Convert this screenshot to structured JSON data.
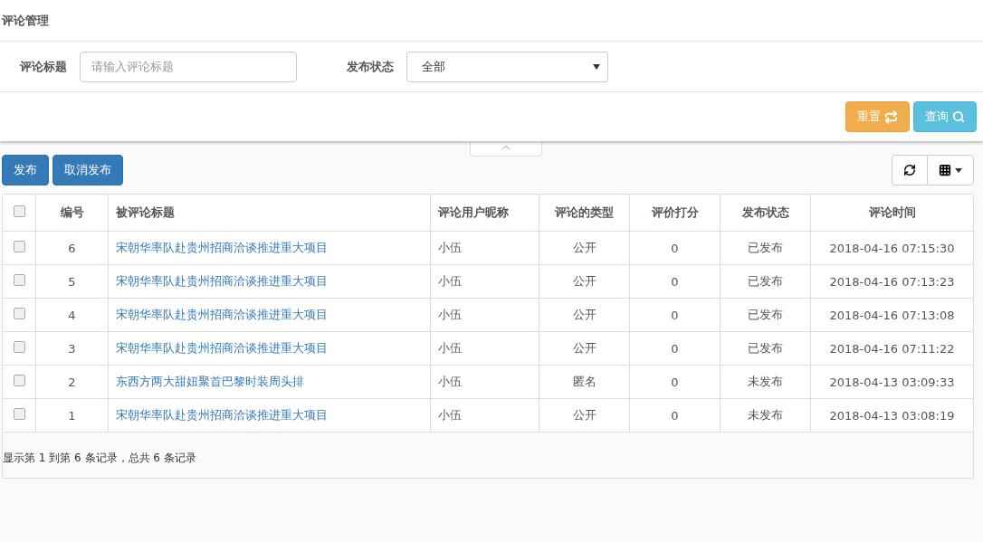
{
  "page_title": "评论管理",
  "filters": [
    {
      "kind": "text",
      "label": "评论标题",
      "placeholder": "请输入评论标题"
    },
    {
      "kind": "select",
      "label": "发布状态",
      "value": "全部"
    }
  ],
  "form_buttons": [
    {
      "label": "重置",
      "kind": "reset"
    },
    {
      "label": "查询",
      "kind": "search"
    }
  ],
  "actions": [
    "发布",
    "取消发布"
  ],
  "table": {
    "select_all_checked": false,
    "columns": [
      "编号",
      "被评论标题",
      "评论用户昵称",
      "评论的类型",
      "评价打分",
      "发布状态",
      "评论时间"
    ],
    "rows": [
      {
        "checked": false,
        "cells": [
          "6",
          "宋朝华率队赴贵州招商洽谈推进重大项目",
          "小伍",
          "公开",
          "0",
          "已发布",
          "2018-04-16 07:15:30"
        ]
      },
      {
        "checked": false,
        "cells": [
          "5",
          "宋朝华率队赴贵州招商洽谈推进重大项目",
          "小伍",
          "公开",
          "0",
          "已发布",
          "2018-04-16 07:13:23"
        ]
      },
      {
        "checked": false,
        "cells": [
          "4",
          "宋朝华率队赴贵州招商洽谈推进重大项目",
          "小伍",
          "公开",
          "0",
          "已发布",
          "2018-04-16 07:13:08"
        ]
      },
      {
        "checked": false,
        "cells": [
          "3",
          "宋朝华率队赴贵州招商洽谈推进重大项目",
          "小伍",
          "公开",
          "0",
          "已发布",
          "2018-04-16 07:11:22"
        ]
      },
      {
        "checked": false,
        "cells": [
          "2",
          "东西方两大甜妞聚首巴黎时装周头排",
          "小伍",
          "匿名",
          "0",
          "未发布",
          "2018-04-13 03:09:33"
        ]
      },
      {
        "checked": false,
        "cells": [
          "1",
          "宋朝华率队赴贵州招商洽谈推进重大项目",
          "小伍",
          "公开",
          "0",
          "未发布",
          "2018-04-13 03:08:19"
        ]
      }
    ],
    "footer": "显示第 1 到第 6 条记录，总共 6 条记录"
  }
}
